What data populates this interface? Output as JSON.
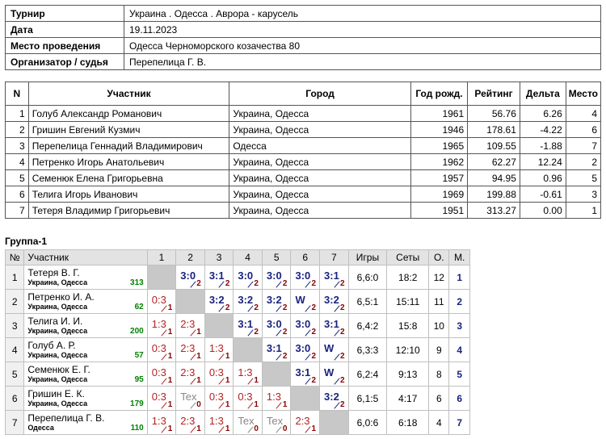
{
  "info": [
    {
      "label": "Турнир",
      "value": "Украина . Одесса . Аврора  - карусель"
    },
    {
      "label": "Дата",
      "value": "19.11.2023"
    },
    {
      "label": "Место проведения",
      "value": "Одесса Черноморского козачества 80"
    },
    {
      "label": "Организатор / судья",
      "value": "Перепелица  Г. В."
    }
  ],
  "participants_headers": [
    "N",
    "Участник",
    "Город",
    "Год рожд.",
    "Рейтинг",
    "Дельта",
    "Место"
  ],
  "participants": [
    {
      "n": "1",
      "name": "Голуб Александр Романович",
      "city": "Украина, Одесса",
      "year": "1961",
      "rating": "56.76",
      "delta": "6.26",
      "place": "4"
    },
    {
      "n": "2",
      "name": "Гришин Евгений Кузмич",
      "city": "Украина, Одесса",
      "year": "1946",
      "rating": "178.61",
      "delta": "-4.22",
      "place": "6"
    },
    {
      "n": "3",
      "name": "Перепелица Геннадий Владимирович",
      "city": "Одесса",
      "year": "1965",
      "rating": "109.55",
      "delta": "-1.88",
      "place": "7"
    },
    {
      "n": "4",
      "name": "Петренко Игорь Анатольевич",
      "city": "Украина, Одесса",
      "year": "1962",
      "rating": "62.27",
      "delta": "12.24",
      "place": "2"
    },
    {
      "n": "5",
      "name": "Семенюк Елена Григорьевна",
      "city": "Украина, Одесса",
      "year": "1957",
      "rating": "94.95",
      "delta": "0.96",
      "place": "5"
    },
    {
      "n": "6",
      "name": "Телига Игорь Иванович",
      "city": "Украина, Одесса",
      "year": "1969",
      "rating": "199.88",
      "delta": "-0.61",
      "place": "3"
    },
    {
      "n": "7",
      "name": "Тетеря Владимир Григорьевич",
      "city": "Украина, Одесса",
      "year": "1951",
      "rating": "313.27",
      "delta": "0.00",
      "place": "1"
    }
  ],
  "group_title": "Группа-1",
  "grid_headers": {
    "num": "№",
    "player": "Участник",
    "cols": [
      "1",
      "2",
      "3",
      "4",
      "5",
      "6",
      "7"
    ],
    "games": "Игры",
    "sets": "Сеты",
    "points": "О.",
    "place": "М."
  },
  "grid_rows": [
    {
      "n": "1",
      "name": "Тетеря В. Г.",
      "city": "Украина, Одесса",
      "rating": "313",
      "cells": [
        null,
        {
          "s": "3:0",
          "p": "2",
          "t": "win"
        },
        {
          "s": "3:1",
          "p": "2",
          "t": "win"
        },
        {
          "s": "3:0",
          "p": "2",
          "t": "win"
        },
        {
          "s": "3:0",
          "p": "2",
          "t": "win"
        },
        {
          "s": "3:0",
          "p": "2",
          "t": "win"
        },
        {
          "s": "3:1",
          "p": "2",
          "t": "win"
        }
      ],
      "games": "6,6:0",
      "sets": "18:2",
      "points": "12",
      "place": "1"
    },
    {
      "n": "2",
      "name": "Петренко И. А.",
      "city": "Украина, Одесса",
      "rating": "62",
      "cells": [
        {
          "s": "0:3",
          "p": "1",
          "t": "loss"
        },
        null,
        {
          "s": "3:2",
          "p": "2",
          "t": "win"
        },
        {
          "s": "3:2",
          "p": "2",
          "t": "win"
        },
        {
          "s": "3:2",
          "p": "2",
          "t": "win"
        },
        {
          "s": "W",
          "p": "2",
          "t": "win"
        },
        {
          "s": "3:2",
          "p": "2",
          "t": "win"
        }
      ],
      "games": "6,5:1",
      "sets": "15:11",
      "points": "11",
      "place": "2"
    },
    {
      "n": "3",
      "name": "Телига И. И.",
      "city": "Украина, Одесса",
      "rating": "200",
      "cells": [
        {
          "s": "1:3",
          "p": "1",
          "t": "loss"
        },
        {
          "s": "2:3",
          "p": "1",
          "t": "loss"
        },
        null,
        {
          "s": "3:1",
          "p": "2",
          "t": "win"
        },
        {
          "s": "3:0",
          "p": "2",
          "t": "win"
        },
        {
          "s": "3:0",
          "p": "2",
          "t": "win"
        },
        {
          "s": "3:1",
          "p": "2",
          "t": "win"
        }
      ],
      "games": "6,4:2",
      "sets": "15:8",
      "points": "10",
      "place": "3"
    },
    {
      "n": "4",
      "name": "Голуб А. Р.",
      "city": "Украина, Одесса",
      "rating": "57",
      "cells": [
        {
          "s": "0:3",
          "p": "1",
          "t": "loss"
        },
        {
          "s": "2:3",
          "p": "1",
          "t": "loss"
        },
        {
          "s": "1:3",
          "p": "1",
          "t": "loss"
        },
        null,
        {
          "s": "3:1",
          "p": "2",
          "t": "win"
        },
        {
          "s": "3:0",
          "p": "2",
          "t": "win"
        },
        {
          "s": "W",
          "p": "2",
          "t": "win"
        }
      ],
      "games": "6,3:3",
      "sets": "12:10",
      "points": "9",
      "place": "4"
    },
    {
      "n": "5",
      "name": "Семенюк Е. Г.",
      "city": "Украина, Одесса",
      "rating": "95",
      "cells": [
        {
          "s": "0:3",
          "p": "1",
          "t": "loss"
        },
        {
          "s": "2:3",
          "p": "1",
          "t": "loss"
        },
        {
          "s": "0:3",
          "p": "1",
          "t": "loss"
        },
        {
          "s": "1:3",
          "p": "1",
          "t": "loss"
        },
        null,
        {
          "s": "3:1",
          "p": "2",
          "t": "win"
        },
        {
          "s": "W",
          "p": "2",
          "t": "win"
        }
      ],
      "games": "6,2:4",
      "sets": "9:13",
      "points": "8",
      "place": "5"
    },
    {
      "n": "6",
      "name": "Гришин Е. К.",
      "city": "Украина, Одесса",
      "rating": "179",
      "cells": [
        {
          "s": "0:3",
          "p": "1",
          "t": "loss"
        },
        {
          "s": "Tex",
          "p": "0",
          "t": "tech"
        },
        {
          "s": "0:3",
          "p": "1",
          "t": "loss"
        },
        {
          "s": "0:3",
          "p": "1",
          "t": "loss"
        },
        {
          "s": "1:3",
          "p": "1",
          "t": "loss"
        },
        null,
        {
          "s": "3:2",
          "p": "2",
          "t": "win"
        }
      ],
      "games": "6,1:5",
      "sets": "4:17",
      "points": "6",
      "place": "6"
    },
    {
      "n": "7",
      "name": "Перепелица Г. В.",
      "city": "Одесса",
      "rating": "110",
      "cells": [
        {
          "s": "1:3",
          "p": "1",
          "t": "loss"
        },
        {
          "s": "2:3",
          "p": "1",
          "t": "loss"
        },
        {
          "s": "1:3",
          "p": "1",
          "t": "loss"
        },
        {
          "s": "Tex",
          "p": "0",
          "t": "tech"
        },
        {
          "s": "Tex",
          "p": "0",
          "t": "tech"
        },
        {
          "s": "2:3",
          "p": "1",
          "t": "loss"
        },
        null
      ],
      "games": "6,0:6",
      "sets": "6:18",
      "points": "4",
      "place": "7"
    }
  ]
}
